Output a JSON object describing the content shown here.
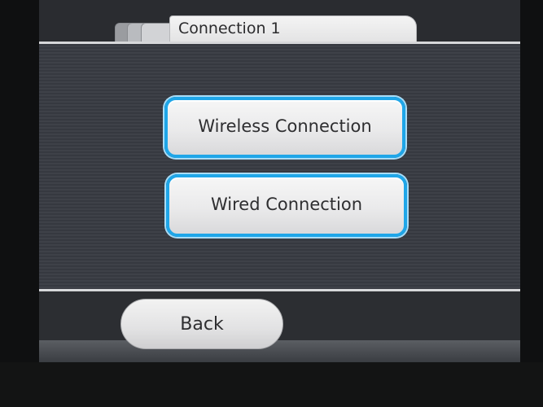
{
  "header": {
    "tab_title": "Connection 1"
  },
  "menu": {
    "options": [
      {
        "label": "Wireless Connection"
      },
      {
        "label": "Wired Connection"
      }
    ]
  },
  "footer": {
    "back_label": "Back"
  },
  "colors": {
    "selection_border": "#1fa6e8",
    "screen_background": "#3b3e44",
    "button_face": "#eaeaeb",
    "text": "#2e2e30"
  }
}
